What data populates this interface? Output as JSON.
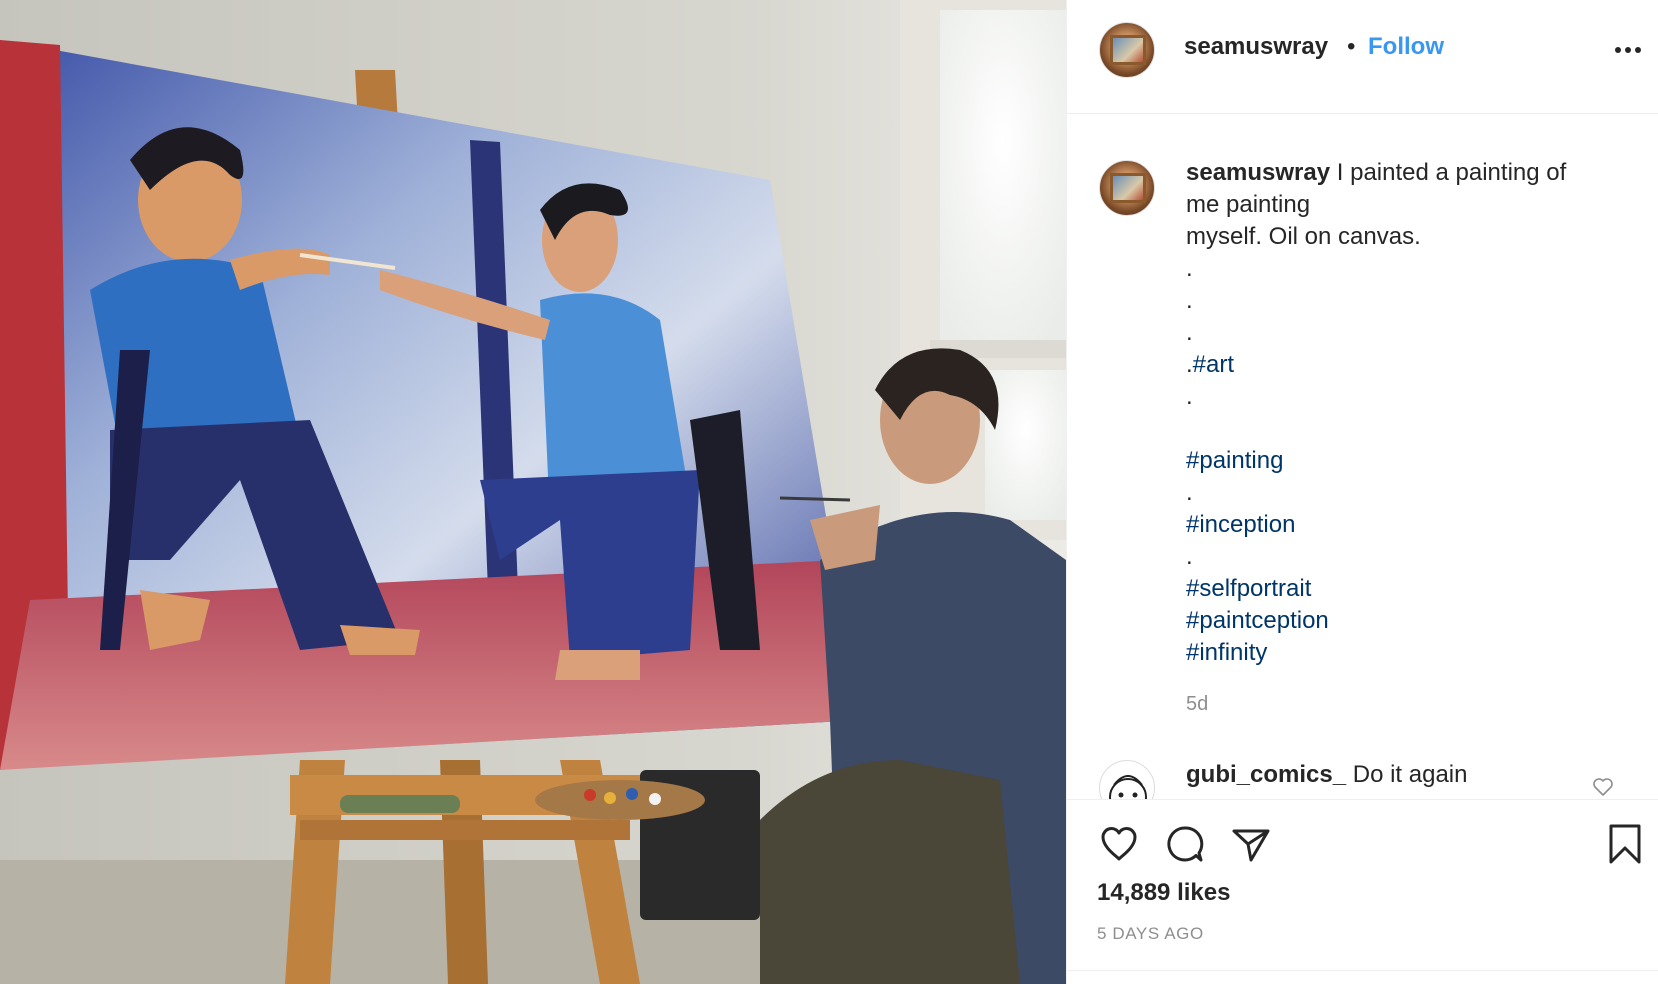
{
  "post": {
    "username": "seamuswray",
    "separator": "•",
    "follow_label": "Follow",
    "more_icon": "more-options-icon"
  },
  "caption": {
    "username": "seamuswray",
    "line1": "I painted a painting of",
    "line2": "me painting",
    "line3": "myself. Oil on canvas.",
    "line4": ".",
    "line5": ".",
    "line6": ".",
    "line7_prefix": ".",
    "line7_tag": "#art",
    "line8": ".",
    "tag_painting": "#painting",
    "line10": ".",
    "tag_inception": "#inception",
    "line12": ".",
    "tag_selfportrait": "#selfportrait",
    "tag_paintception": "#paintception",
    "tag_infinity": "#infinity",
    "time": "5d"
  },
  "comment": {
    "username": "gubi_comics_",
    "text": "Do it again"
  },
  "actions": {
    "likes": "14,889 likes",
    "posted": "5 DAYS AGO"
  },
  "colors": {
    "follow": "#3897f0",
    "hashtag": "#003569",
    "muted": "#8e8e8e"
  }
}
